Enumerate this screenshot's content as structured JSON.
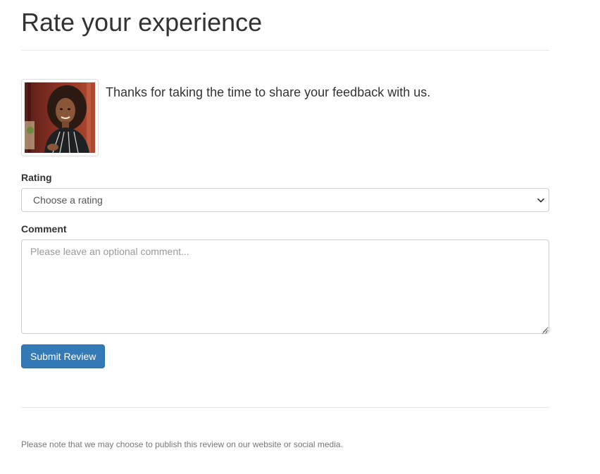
{
  "page": {
    "title": "Rate your experience",
    "intro_text": "Thanks for taking the time to share your feedback with us.",
    "avatar_icon": "person-photo"
  },
  "form": {
    "rating_label": "Rating",
    "rating_selected": "Choose a rating",
    "comment_label": "Comment",
    "comment_placeholder": "Please leave an optional comment...",
    "comment_value": "",
    "submit_label": "Submit Review"
  },
  "footer": {
    "note": "Please note that we may choose to publish this review on our website or social media."
  },
  "colors": {
    "primary": "#337ab7",
    "text": "#333333",
    "muted": "#777777",
    "border": "#cccccc"
  }
}
